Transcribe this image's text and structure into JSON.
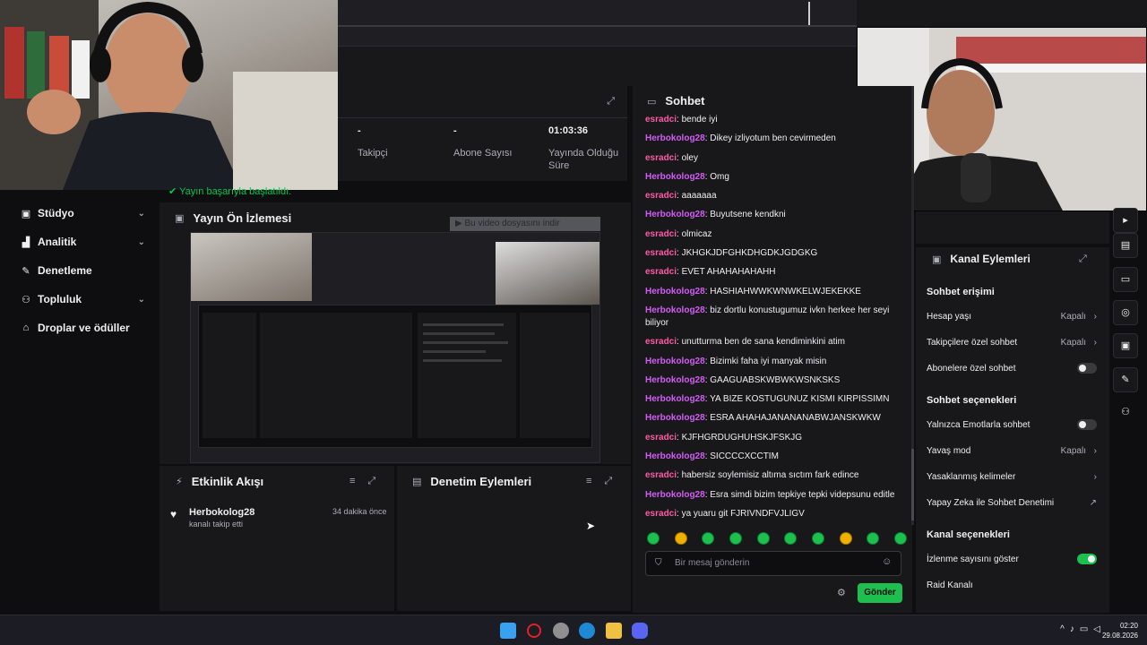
{
  "window": {
    "controls": "— ▢ ✕"
  },
  "stats": {
    "followers_value": "-",
    "followers_label": "Takipçi",
    "subs_value": "-",
    "subs_label": "Abone Sayısı",
    "live_value": "01:03:36",
    "live_label": "Yayında Olduğu Süre"
  },
  "notice": "Yayın başarıyla başlatıldı.",
  "sidebar": {
    "items": [
      {
        "label": "Stüdyo",
        "icon": "tv-icon",
        "has_chevron": true
      },
      {
        "label": "Analitik",
        "icon": "chart-icon",
        "has_chevron": true
      },
      {
        "label": "Denetleme",
        "icon": "wrench-icon",
        "has_chevron": false
      },
      {
        "label": "Topluluk",
        "icon": "people-icon",
        "has_chevron": true
      },
      {
        "label": "Droplar ve ödüller",
        "icon": "gift-icon",
        "has_chevron": false
      }
    ]
  },
  "preview": {
    "title": "Yayın Ön İzlemesi",
    "popup": "▶ Bu video dosyasını indir"
  },
  "activity": {
    "title": "Etkinlik Akışı",
    "item": {
      "name": "Herbokolog28",
      "sub": "kanalı takip etti",
      "time": "34 dakika önce"
    }
  },
  "moderation": {
    "title": "Denetim Eylemleri"
  },
  "chat": {
    "title": "Sohbet",
    "messages": [
      {
        "user": "esradci",
        "text": "bende iyi"
      },
      {
        "user": "Herbokolog28",
        "text": "Dikey izliyotum ben cevirmeden"
      },
      {
        "user": "esradci",
        "text": "oley"
      },
      {
        "user": "Herbokolog28",
        "text": "Omg"
      },
      {
        "user": "esradci",
        "text": "aaaaaaa"
      },
      {
        "user": "Herbokolog28",
        "text": "Buyutsene kendkni"
      },
      {
        "user": "esradci",
        "text": "olmicaz"
      },
      {
        "user": "esradci",
        "text": "JKHGKJDFGHKDHGDKJGDGKG"
      },
      {
        "user": "esradci",
        "text": "EVET AHAHAHAHAHH"
      },
      {
        "user": "Herbokolog28",
        "text": "HASHIAHWWKWNWKELWJEKEKKE"
      },
      {
        "user": "Herbokolog28",
        "text": "biz dortlu konustugumuz ivkn herkee her seyi biliyor"
      },
      {
        "user": "esradci",
        "text": "unutturma ben de sana kendiminkini atim"
      },
      {
        "user": "Herbokolog28",
        "text": "Bizimki faha iyi manyak misin"
      },
      {
        "user": "Herbokolog28",
        "text": "GAAGUABSKWBWKWSNKSKS"
      },
      {
        "user": "Herbokolog28",
        "text": "YA BIZE KOSTUGUNUZ KISMI KIRPISSIMN"
      },
      {
        "user": "Herbokolog28",
        "text": "ESRA AHAHAJANANANABWJANSKWKW"
      },
      {
        "user": "esradci",
        "text": "KJFHGRDUGHUHSKJFSKJG"
      },
      {
        "user": "Herbokolog28",
        "text": "SICCCCXCCTIM"
      },
      {
        "user": "esradci",
        "text": "habersiz soylemisiz altıma sıctım fark edince"
      },
      {
        "user": "Herbokolog28",
        "text": "Esra simdi bizim tepkiye tepki videpsunu editle"
      },
      {
        "user": "esradci",
        "text": "ya yuaru git FJRIVNDFVJLIGV"
      }
    ],
    "input_placeholder": "Bir mesaj gönderin",
    "send_label": "Gönder"
  },
  "channel": {
    "title": "Kanal Eylemleri",
    "access_title": "Sohbet erişimi",
    "account_age": {
      "label": "Hesap yaşı",
      "value": "Kapalı"
    },
    "followers_only": {
      "label": "Takipçilere özel sohbet",
      "value": "Kapalı"
    },
    "subs_only": {
      "label": "Abonelere özel sohbet",
      "on": false
    },
    "options_title": "Sohbet seçenekleri",
    "emote_only": {
      "label": "Yalnızca Emotlarla sohbet",
      "on": false
    },
    "slow_mode": {
      "label": "Yavaş mod",
      "value": "Kapalı"
    },
    "banned_words": {
      "label": "Yasaklanmış kelimeler"
    },
    "ai_mod": {
      "label": "Yapay Zeka ile Sohbet Denetimi"
    },
    "channel_options_title": "Kanal seçenekleri",
    "show_viewers": {
      "label": "İzlenme sayısını göster",
      "on": true
    },
    "raid": {
      "label": "Raid Kanalı"
    }
  },
  "taskbar": {
    "time": "02:20",
    "date": "29.08.2026"
  },
  "colors": {
    "accent": "#1dbf4e",
    "user_esradci": "#ff5aa5",
    "user_herbokolog": "#d25cf5"
  }
}
